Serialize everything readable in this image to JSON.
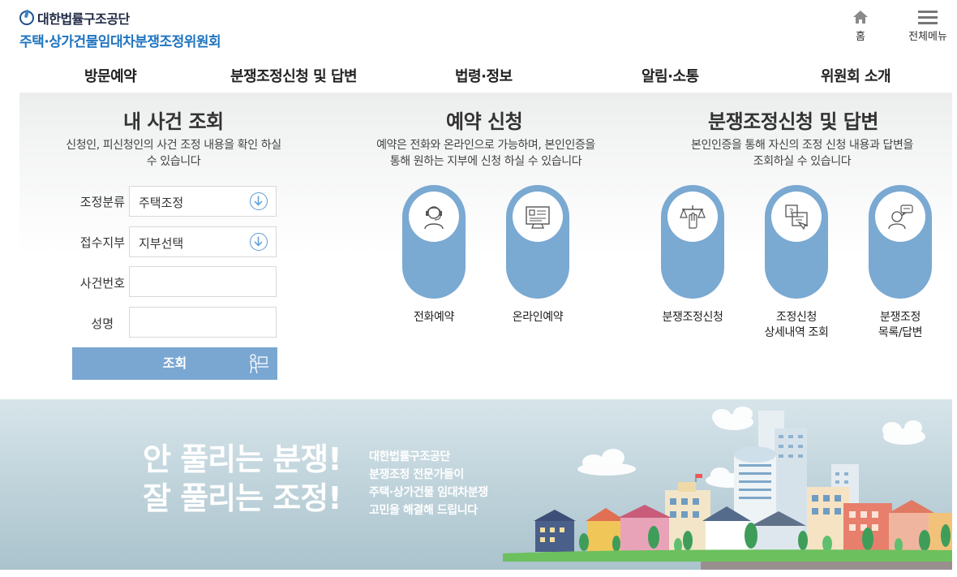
{
  "header": {
    "logo_org": "대한법률구조공단",
    "logo_committee": "주택·상가건물임대차분쟁조정위원회",
    "home_label": "홈",
    "menu_label": "전체메뉴"
  },
  "nav": {
    "items": [
      "방문예약",
      "분쟁조정신청 및 답변",
      "법령·정보",
      "알림·소통",
      "위원회 소개"
    ]
  },
  "case_lookup": {
    "title": "내 사건 조회",
    "desc_line1": "신청인, 피신청인의 사건 조정 내용을 확인 하실",
    "desc_line2": "수 있습니다",
    "fields": [
      {
        "label": "조정분류",
        "value": "주택조정"
      },
      {
        "label": "접수지부",
        "value": "지부선택"
      },
      {
        "label": "사건번호",
        "value": ""
      },
      {
        "label": "성명",
        "value": ""
      }
    ],
    "submit_label": "조회"
  },
  "reservation": {
    "title": "예약 신청",
    "desc_line1": "예약은 전화와 온라인으로 가능하며, 본인인증을",
    "desc_line2": "통해 원하는 지부에 신청 하실 수 있습니다",
    "items": [
      {
        "label": "전화예약",
        "icon": "headset-agent-icon"
      },
      {
        "label": "온라인예약",
        "icon": "online-form-icon"
      }
    ]
  },
  "dispute": {
    "title": "분쟁조정신청 및 답변",
    "desc_line1": "본인인증을 통해 자신의 조정 신청 내용과 답변을",
    "desc_line2": "조회하실 수 있습니다",
    "items": [
      {
        "label_line1": "분쟁조정신청",
        "label_line2": "",
        "icon": "scale-hand-icon"
      },
      {
        "label_line1": "조정신청",
        "label_line2": "상세내역 조회",
        "icon": "document-search-icon"
      },
      {
        "label_line1": "분쟁조정",
        "label_line2": "목록/답변",
        "icon": "person-speech-icon"
      }
    ]
  },
  "banner": {
    "headline_line1": "안 풀리는 분쟁!",
    "headline_line2": "잘 풀리는 조정!",
    "sub_line1": "대한법률구조공단",
    "sub_line2": "분쟁조정 전문가들이",
    "sub_line3": "주택·상가건물 임대차분쟁",
    "sub_line4": "고민을 해결해 드립니다"
  },
  "colors": {
    "accent_blue": "#1f74c0",
    "pill_blue": "#7aa9d2",
    "button_blue": "#7aa7d2",
    "banner_top": "#d7e5ea",
    "banner_bottom": "#aac3cd"
  }
}
